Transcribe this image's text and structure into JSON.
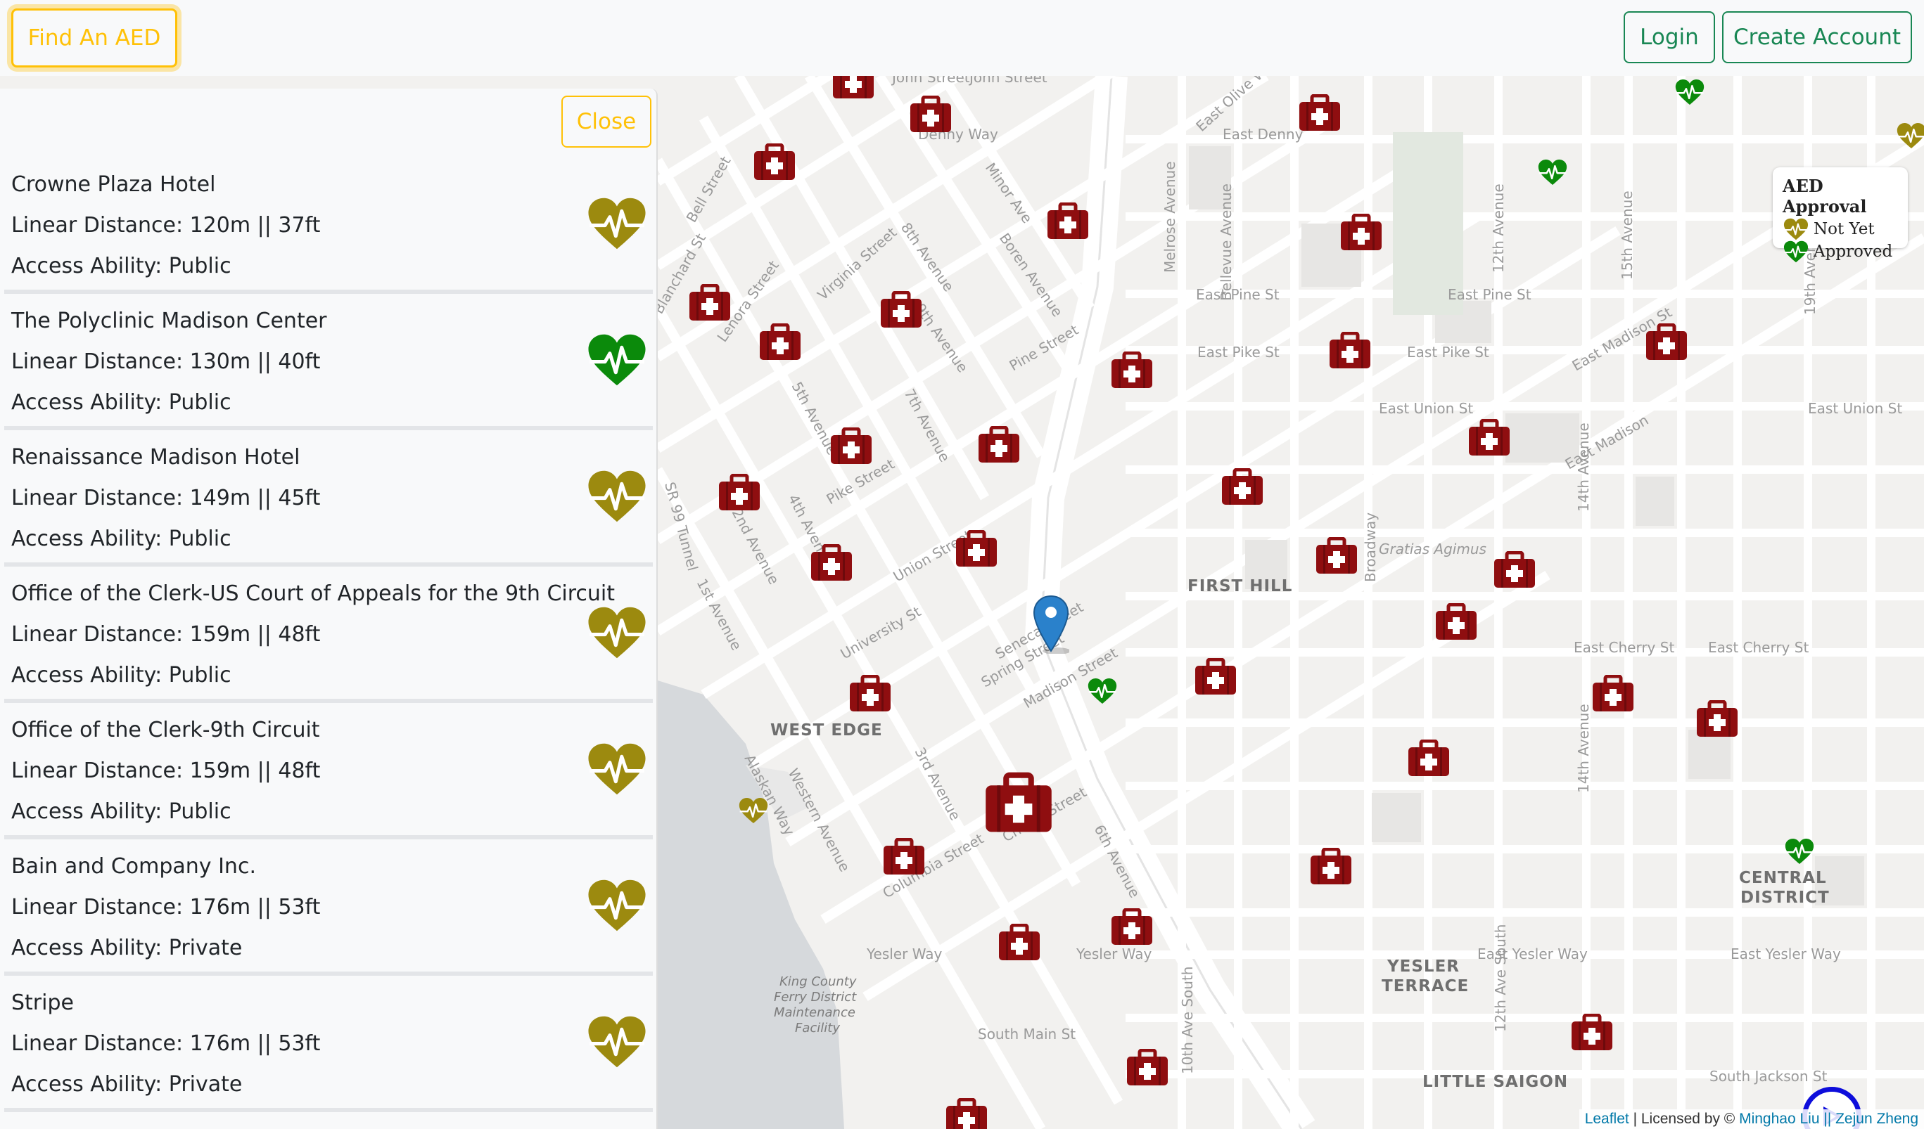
{
  "navbar": {
    "find_label": "Find An AED",
    "login_label": "Login",
    "create_label": "Create Account"
  },
  "panel": {
    "close_label": "Close",
    "items": [
      {
        "name": "Crowne Plaza Hotel",
        "distance": "Linear Distance: 120m || 37ft",
        "access": "Access Ability: Public",
        "status": "not-yet"
      },
      {
        "name": "The Polyclinic Madison Center",
        "distance": "Linear Distance: 130m || 40ft",
        "access": "Access Ability: Public",
        "status": "approved"
      },
      {
        "name": "Renaissance Madison Hotel",
        "distance": "Linear Distance: 149m || 45ft",
        "access": "Access Ability: Public",
        "status": "not-yet"
      },
      {
        "name": "Office of the Clerk-US Court of Appeals for the 9th Circuit",
        "distance": "Linear Distance: 159m || 48ft",
        "access": "Access Ability: Public",
        "status": "not-yet"
      },
      {
        "name": "Office of the Clerk-9th Circuit",
        "distance": "Linear Distance: 159m || 48ft",
        "access": "Access Ability: Public",
        "status": "not-yet"
      },
      {
        "name": "Bain and Company Inc.",
        "distance": "Linear Distance: 176m || 53ft",
        "access": "Access Ability: Private",
        "status": "not-yet"
      },
      {
        "name": "Stripe",
        "distance": "Linear Distance: 176m || 53ft",
        "access": "Access Ability: Private",
        "status": "not-yet"
      }
    ]
  },
  "legend": {
    "title": "AED Approval",
    "not_yet": "Not Yet",
    "approved": "Approved"
  },
  "attribution": {
    "leaflet": "Leaflet",
    "licensed": " | Licensed by © ",
    "authors": "Minghao Liu || Zejun Zheng"
  },
  "map": {
    "streets": [
      "John Street",
      "John Street",
      "Denny Way",
      "East Denny",
      "East Olive Way",
      "Bell Street",
      "Blanchard St",
      "Lenora Street",
      "Virginia Street",
      "8th Avenue",
      "9th Avenue",
      "Minor Ave",
      "Boren Avenue",
      "Melrose Avenue",
      "Bellevue Avenue",
      "Broadway",
      "12th Avenue",
      "15th Avenue",
      "19th Avenue",
      "East Pine St",
      "East Pine St",
      "Pine Street",
      "East Pike St",
      "East Pike St",
      "Pike Street",
      "East Union St",
      "East Union St",
      "East Madison",
      "East Madison St",
      "Union Street",
      "University St",
      "Seneca Street",
      "Spring Street",
      "Madison Street",
      "Cherry Street",
      "Columbia Street",
      "Yesler Way",
      "Yesler Way",
      "East Yesler Way",
      "East Yesler Way",
      "East Cherry St",
      "East Cherry St",
      "South Main St",
      "South Jackson St",
      "4th Avenue",
      "5th Avenue",
      "6th Avenue",
      "7th Avenue",
      "3rd Avenue",
      "2nd Avenue",
      "1st Avenue",
      "Western Avenue",
      "Alaskan Way",
      "SR 99 Tunnel",
      "Gratias Agimus",
      "14th Avenue",
      "12th Ave South",
      "10th Ave South",
      "14th Avenue"
    ],
    "neighborhoods": [
      "FIRST HILL",
      "WEST EDGE",
      "YESLER",
      "TERRACE",
      "CENTRAL",
      "DISTRICT",
      "LITTLE SAIGON"
    ],
    "facility": [
      "King County",
      "Ferry District",
      "Maintenance",
      "Facility"
    ]
  },
  "colors": {
    "not_yet": "#9c8a0f",
    "approved": "#0b8a0b",
    "kit": "#8f0e10",
    "accent_yellow": "#ffc107",
    "accent_green": "#198754",
    "pin": "#2a81cb"
  }
}
